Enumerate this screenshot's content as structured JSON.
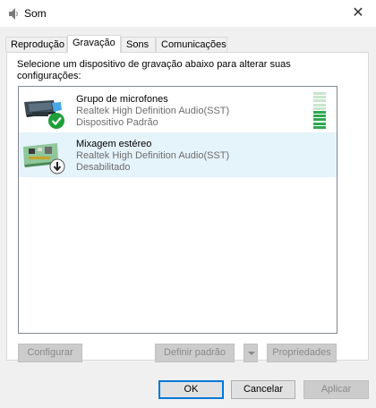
{
  "window": {
    "title": "Som",
    "close_glyph": "✕"
  },
  "tabs": [
    {
      "label": "Reprodução",
      "active": false
    },
    {
      "label": "Gravação",
      "active": true
    },
    {
      "label": "Sons",
      "active": false
    },
    {
      "label": "Comunicações",
      "active": false
    }
  ],
  "recording": {
    "instruction": "Selecione um dispositivo de gravação abaixo para alterar suas configurações:",
    "devices": [
      {
        "name": "Grupo de microfones",
        "driver": "Realtek High Definition Audio(SST)",
        "status": "Dispositivo Padrão",
        "icon": "microphone-array-icon",
        "badge": "default-check-icon",
        "selected": false,
        "level_bars_total": 10,
        "level_bars_lit": 5
      },
      {
        "name": "Mixagem estéreo",
        "driver": "Realtek High Definition Audio(SST)",
        "status": "Desabilitado",
        "icon": "sound-card-icon",
        "badge": "disabled-arrow-icon",
        "selected": true
      }
    ]
  },
  "panel_buttons": {
    "configure": "Configurar",
    "set_default": "Definir padrão",
    "properties": "Propriedades"
  },
  "dialog_buttons": {
    "ok": "OK",
    "cancel": "Cancelar",
    "apply": "Aplicar"
  },
  "colors": {
    "accent": "#0078d7",
    "check_green": "#1e9e3a",
    "level_lit": "#2fa84f",
    "level_unlit": "#c9e6cf",
    "selection": "#e5f3fb"
  }
}
